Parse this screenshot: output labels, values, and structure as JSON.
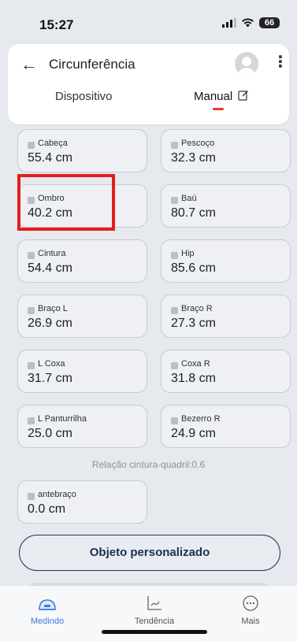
{
  "status": {
    "time": "15:27",
    "battery": "66"
  },
  "header": {
    "title": "Circunferência",
    "tabs": {
      "device": "Dispositivo",
      "manual": "Manual"
    }
  },
  "measurements": [
    {
      "label": "Cabeça",
      "value": "55.4 cm"
    },
    {
      "label": "Pescoço",
      "value": "32.3 cm"
    },
    {
      "label": "Ombro",
      "value": "40.2 cm"
    },
    {
      "label": "Baú",
      "value": "80.7 cm"
    },
    {
      "label": "Cintura",
      "value": "54.4 cm"
    },
    {
      "label": "Hip",
      "value": "85.6 cm"
    },
    {
      "label": "Braço L",
      "value": "26.9 cm"
    },
    {
      "label": "Braço R",
      "value": "27.3 cm"
    },
    {
      "label": "L Coxa",
      "value": "31.7 cm"
    },
    {
      "label": "Coxa R",
      "value": "31.8 cm"
    },
    {
      "label": "L Panturrilha",
      "value": "25.0 cm"
    },
    {
      "label": "Bezerro R",
      "value": "24.9 cm"
    }
  ],
  "ratio_text": "Relação cintura-quadril:0.6",
  "forearm": {
    "label": "antebraço",
    "value": "0.0 cm"
  },
  "custom_button": "Objeto personalizado",
  "bottom_nav": {
    "measure": "Medindo",
    "trend": "Tendência",
    "more": "Mais"
  },
  "colors": {
    "accent": "#3b7bd8",
    "highlight": "#e41d1d",
    "tab_indicator": "#e53b2e"
  }
}
